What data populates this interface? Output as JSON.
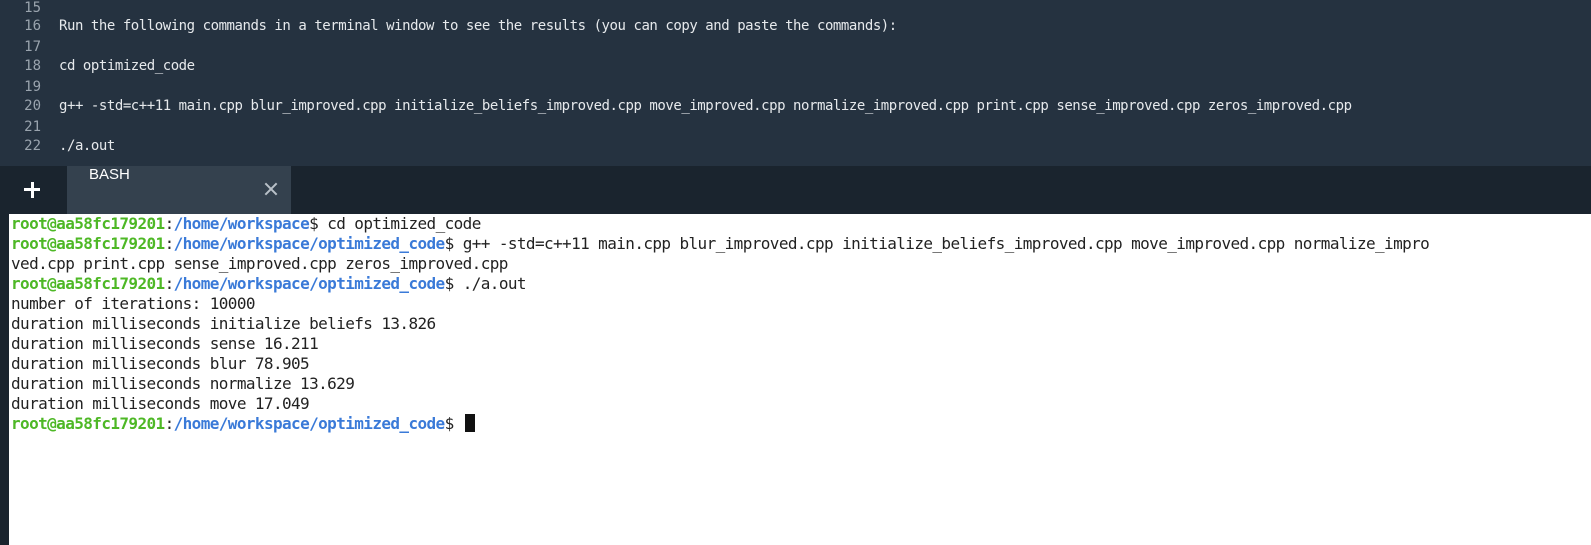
{
  "editor": {
    "lines": [
      {
        "num": "15",
        "text": ""
      },
      {
        "num": "16",
        "text": "Run the following commands in a terminal window to see the results (you can copy and paste the commands):"
      },
      {
        "num": "17",
        "text": ""
      },
      {
        "num": "18",
        "text": "cd optimized_code"
      },
      {
        "num": "19",
        "text": ""
      },
      {
        "num": "20",
        "text": "g++ -std=c++11 main.cpp blur_improved.cpp initialize_beliefs_improved.cpp move_improved.cpp normalize_improved.cpp print.cpp sense_improved.cpp zeros_improved.cpp"
      },
      {
        "num": "21",
        "text": ""
      },
      {
        "num": "22",
        "text": "./a.out"
      }
    ]
  },
  "tabs": {
    "add_icon": "plus-icon",
    "active_label": "BASH",
    "close_icon": "close-icon"
  },
  "terminal": {
    "prompt_user": "root@aa58fc179201",
    "prompt_colon": ":",
    "prompt_dollar": "$",
    "path_workspace": "/home/workspace",
    "path_optimized": "/home/workspace/optimized_code",
    "cmd_cd": " cd optimized_code",
    "cmd_compile_part1": " g++ -std=c++11 main.cpp blur_improved.cpp initialize_beliefs_improved.cpp move_improved.cpp normalize_impro",
    "cmd_compile_part2": "ved.cpp print.cpp sense_improved.cpp zeros_improved.cpp",
    "cmd_run": " ./a.out",
    "output": [
      "number of iterations: 10000",
      "duration milliseconds initialize beliefs 13.826",
      "duration milliseconds sense 16.211",
      "duration milliseconds blur 78.905",
      "duration milliseconds normalize 13.629",
      "duration milliseconds move 17.049"
    ],
    "final_cmd": " "
  },
  "colors": {
    "editor_bg": "#253240",
    "tabbar_bg": "#1a242e",
    "active_tab_bg": "#34414e",
    "prompt_user": "#4eb826",
    "prompt_path": "#3a7ad8"
  }
}
